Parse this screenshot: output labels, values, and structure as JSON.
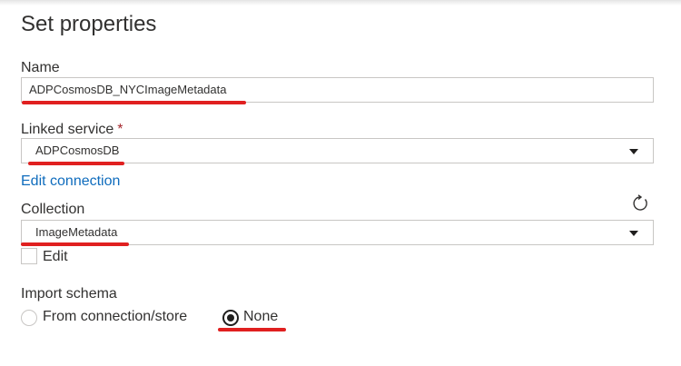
{
  "panel": {
    "title": "Set properties"
  },
  "name_field": {
    "label": "Name",
    "value": "ADPCosmosDB_NYCImageMetadata"
  },
  "linked_service": {
    "label": "Linked service",
    "required_mark": "*",
    "value": "ADPCosmosDB",
    "edit_link": "Edit connection"
  },
  "collection": {
    "label": "Collection",
    "value": "ImageMetadata",
    "edit_label": "Edit",
    "edit_checked": false,
    "refresh_icon": "refresh-icon"
  },
  "import_schema": {
    "label": "Import schema",
    "options": [
      {
        "label": "From connection/store",
        "selected": false
      },
      {
        "label": "None",
        "selected": true
      }
    ]
  },
  "colors": {
    "annotation_underline": "#e02020",
    "link": "#0f6cbd",
    "required": "#a4262c"
  }
}
